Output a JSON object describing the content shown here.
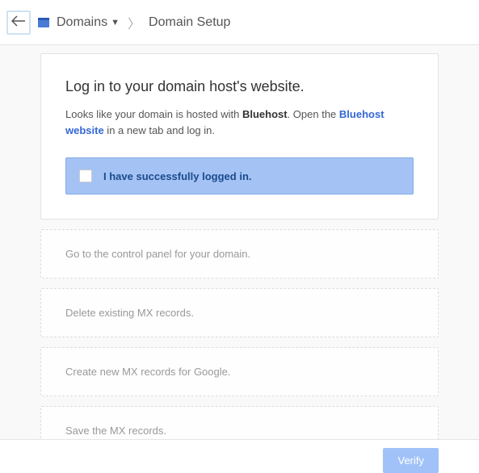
{
  "breadcrumb": {
    "root": "Domains",
    "current": "Domain Setup"
  },
  "step": {
    "title": "Log in to your domain host's website.",
    "intro_pre": "Looks like your domain is hosted with ",
    "host_name": "Bluehost",
    "intro_mid": ". Open the ",
    "link_text": "Bluehost website",
    "intro_post": " in a new tab and log in.",
    "checkbox_label": "I have successfully logged in."
  },
  "other_steps": [
    "Go to the control panel for your domain.",
    "Delete existing MX records.",
    "Create new MX records for Google.",
    "Save the MX records."
  ],
  "footer": {
    "verify": "Verify"
  }
}
